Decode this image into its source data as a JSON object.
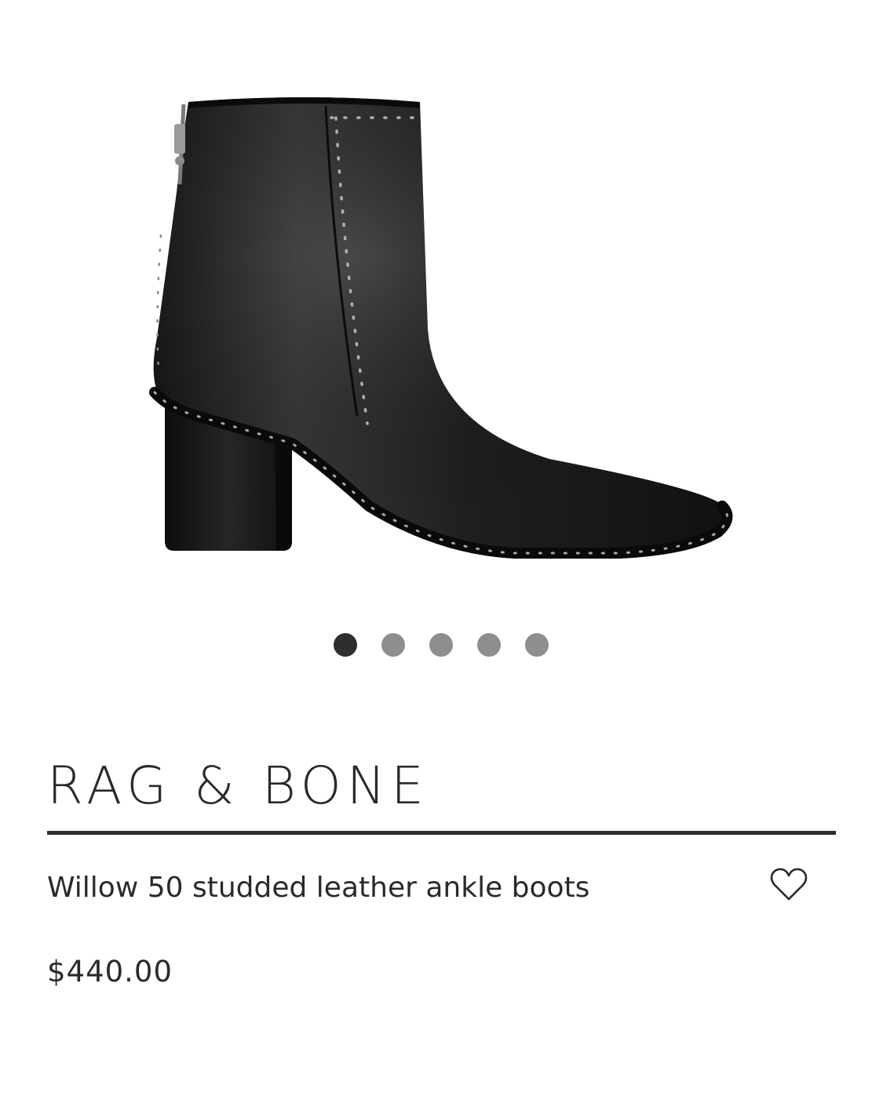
{
  "product": {
    "brand": "RAG & BONE",
    "name": "Willow 50 studded leather ankle boots",
    "price": "$440.00"
  },
  "gallery": {
    "image_count": 5,
    "active_index": 0,
    "image_subject": "black leather ankle boot with studded trim"
  },
  "icons": {
    "wishlist": "heart-outline-icon"
  },
  "colors": {
    "text": "#2a2a2a",
    "dot_active": "#2e2e2e",
    "dot_inactive": "#8e8e8e",
    "rule": "#2e2e2e"
  }
}
